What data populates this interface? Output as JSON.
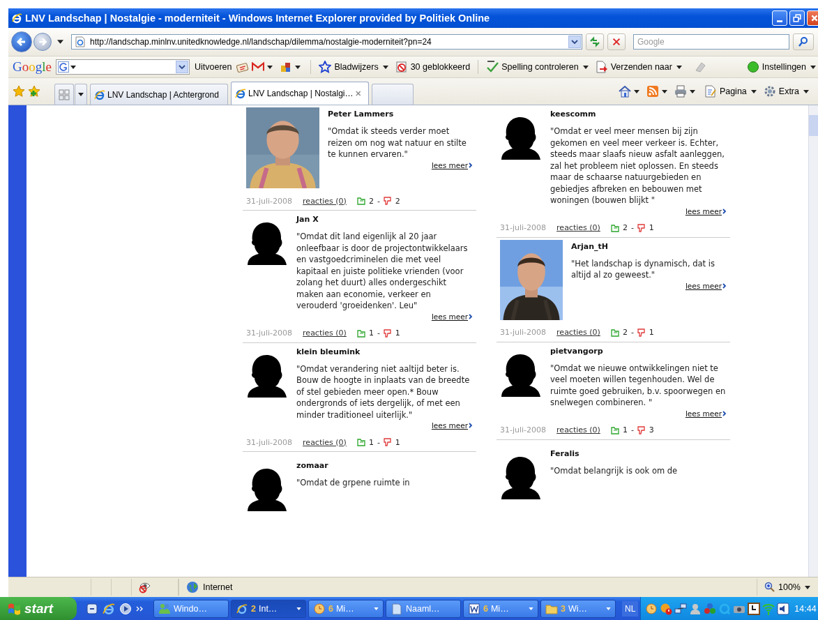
{
  "window": {
    "title": "LNV Landschap | Nostalgie - moderniteit - Windows Internet Explorer provided by Politiek Online"
  },
  "address_bar": {
    "value": "http://landschap.minlnv.unitedknowledge.nl/landschap/dilemma/nostalgie-moderniteit?pn=24"
  },
  "search": {
    "placeholder": "Google"
  },
  "google_toolbar": {
    "logo": "Google",
    "go": "Uitvoeren",
    "items": [
      {
        "label": "Bladwijzers"
      },
      {
        "label": "30 geblokkeerd"
      },
      {
        "label": "Spelling controleren"
      },
      {
        "label": "Verzenden naar"
      },
      {
        "label": "Instellingen"
      }
    ]
  },
  "tabs": [
    {
      "label": "LNV Landschap | Achtergrond",
      "selected": false
    },
    {
      "label": "LNV Landschap | Nostalgi…",
      "selected": true
    }
  ],
  "command_bar": [
    "Pagina",
    "Extra"
  ],
  "columns": [
    [
      {
        "name": "Peter Lammers",
        "quote": "\"Omdat ik steeds verder moet reizen om nog wat natuur en stilte te kunnen ervaren.\"",
        "link": "lees meer",
        "date": "31-juli-2008",
        "reactions": "reacties (0)",
        "up": "2",
        "separator": "-",
        "down": "2"
      },
      {
        "kind": "silhouette",
        "name": "Jan X",
        "quote": "\"Omdat dit land eigenlijk al 20 jaar onleefbaar is door de projectontwikkelaars en vastgoedcriminelen die met veel kapitaal en juiste politieke vrienden (voor zolang het duurt) alles ondergeschikt maken aan economie, verkeer en verouderd 'groeidenken'. Leu\"",
        "link": "lees meer",
        "date": "31-juli-2008",
        "reactions": "reacties (0)",
        "up": "1",
        "separator": "-",
        "down": "1"
      },
      {
        "kind": "silhouette",
        "name": "klein bleumink",
        "quote": "\"Omdat verandering niet aaltijd beter is. Bouw de hoogte in inplaats van de breedte of stel gebieden meer open.* Bouw ondergronds of iets dergelijk, of met een minder traditioneel uiterlijk.\"",
        "link": "lees meer",
        "date": "31-juli-2008",
        "reactions": "reacties (0)",
        "up": "1",
        "separator": "-",
        "down": "1"
      },
      {
        "kind": "silhouette",
        "name": "zomaar",
        "quote": "\"Omdat de grpene ruimte in"
      }
    ],
    [
      {
        "kind": "silhouette",
        "name": "keescomm",
        "quote": "\"Omdat er veel meer mensen bij zijn gekomen en veel meer verkeer is. Echter, steeds maar slaafs nieuw asfalt aanleggen, zal het probleem niet oplossen. En steeds maar de schaarse natuurgebieden en gebiedjes afbreken en bebouwen met woningen (bouwen blijkt \"",
        "link": "lees meer",
        "date": "31-juli-2008",
        "reactions": "reacties (0)",
        "up": "2",
        "separator": "-",
        "down": "1"
      },
      {
        "name": "Arjan_tH",
        "quote": "\"Het landschap is dynamisch, dat is altijd al zo geweest.\"",
        "link": "lees meer",
        "date": "31-juli-2008",
        "reactions": "reacties (0)",
        "up": "2",
        "separator": "-",
        "down": "1"
      },
      {
        "kind": "silhouette",
        "name": "pietvangorp",
        "quote": "\"Omdat we nieuwe ontwikkelingen niet te veel moeten willen tegenhouden. Wel de ruimte goed gebruiken, b.v. spoorwegen en snelwegen combineren. \"",
        "link": "lees meer",
        "date": "31-juli-2008",
        "reactions": "reacties (0)",
        "up": "1",
        "separator": "-",
        "down": "3"
      },
      {
        "kind": "silhouette",
        "name": "Feralis",
        "quote": "\"Omdat belangrijk is ook om de"
      }
    ]
  ],
  "status_bar": {
    "zone": "Internet",
    "zoom": "100%"
  },
  "taskbar": {
    "start": "start",
    "tasks": [
      {
        "label": "Windo…",
        "selected": false
      },
      {
        "count": "2",
        "label": "Int…",
        "selected": true
      },
      {
        "count": "6",
        "label": "Mi…",
        "selected": false
      },
      {
        "label": "Naaml…",
        "selected": false
      },
      {
        "count": "6",
        "label": "Mi…",
        "selected": false
      },
      {
        "count": "3",
        "label": "Wi…",
        "selected": false
      }
    ],
    "language": "NL",
    "clock": "14:44"
  }
}
